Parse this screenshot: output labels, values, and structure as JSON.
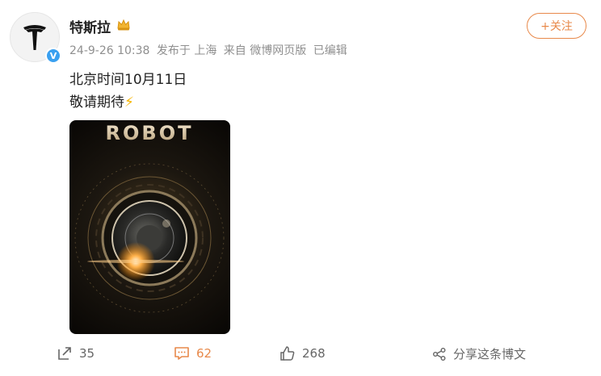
{
  "user": {
    "name": "特斯拉",
    "verified_badge": "V"
  },
  "meta": {
    "timestamp": "24-9-26 10:38",
    "posted_from": "发布于 上海",
    "source": "来自 微博网页版",
    "edited": "已编辑"
  },
  "follow_button": "+关注",
  "post": {
    "line1": "北京时间10月11日",
    "line2": "敬请期待",
    "emoji": "⚡"
  },
  "image": {
    "title_text": "ROBOT"
  },
  "actions": {
    "share_count": "35",
    "comment_count": "62",
    "like_count": "268",
    "share_post_label": "分享这条博文"
  },
  "colors": {
    "accent": "#e8894a",
    "verified": "#3aa0f0"
  }
}
